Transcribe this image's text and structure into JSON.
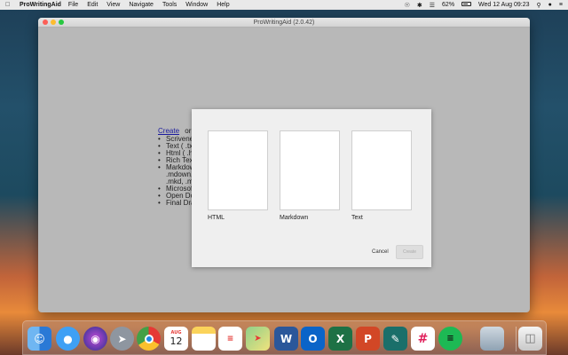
{
  "menubar": {
    "apple": "",
    "app_name": "ProWritingAid",
    "items": [
      "File",
      "Edit",
      "View",
      "Navigate",
      "Tools",
      "Window",
      "Help"
    ],
    "battery": "62%",
    "datetime": "Wed 12 Aug  09:23"
  },
  "window": {
    "title": "ProWritingAid (2.0.42)"
  },
  "start_panel": {
    "create_link": "Create",
    "or_text": "or",
    "items": [
      "Scrivener",
      "Text ( .tx",
      "Html ( .h",
      "Rich Tex",
      "Markdow"
    ],
    "sub_items": [
      ".mdown,",
      ".mkd, .m"
    ],
    "items2": [
      "Microsof",
      "Open Do",
      "Final Dra"
    ]
  },
  "dialog": {
    "options": [
      {
        "label": "HTML"
      },
      {
        "label": "Markdown"
      },
      {
        "label": "Text"
      }
    ],
    "cancel_label": "Cancel",
    "create_label": "Create"
  },
  "dock": {
    "calendar_month": "AUG",
    "calendar_day": "12"
  }
}
